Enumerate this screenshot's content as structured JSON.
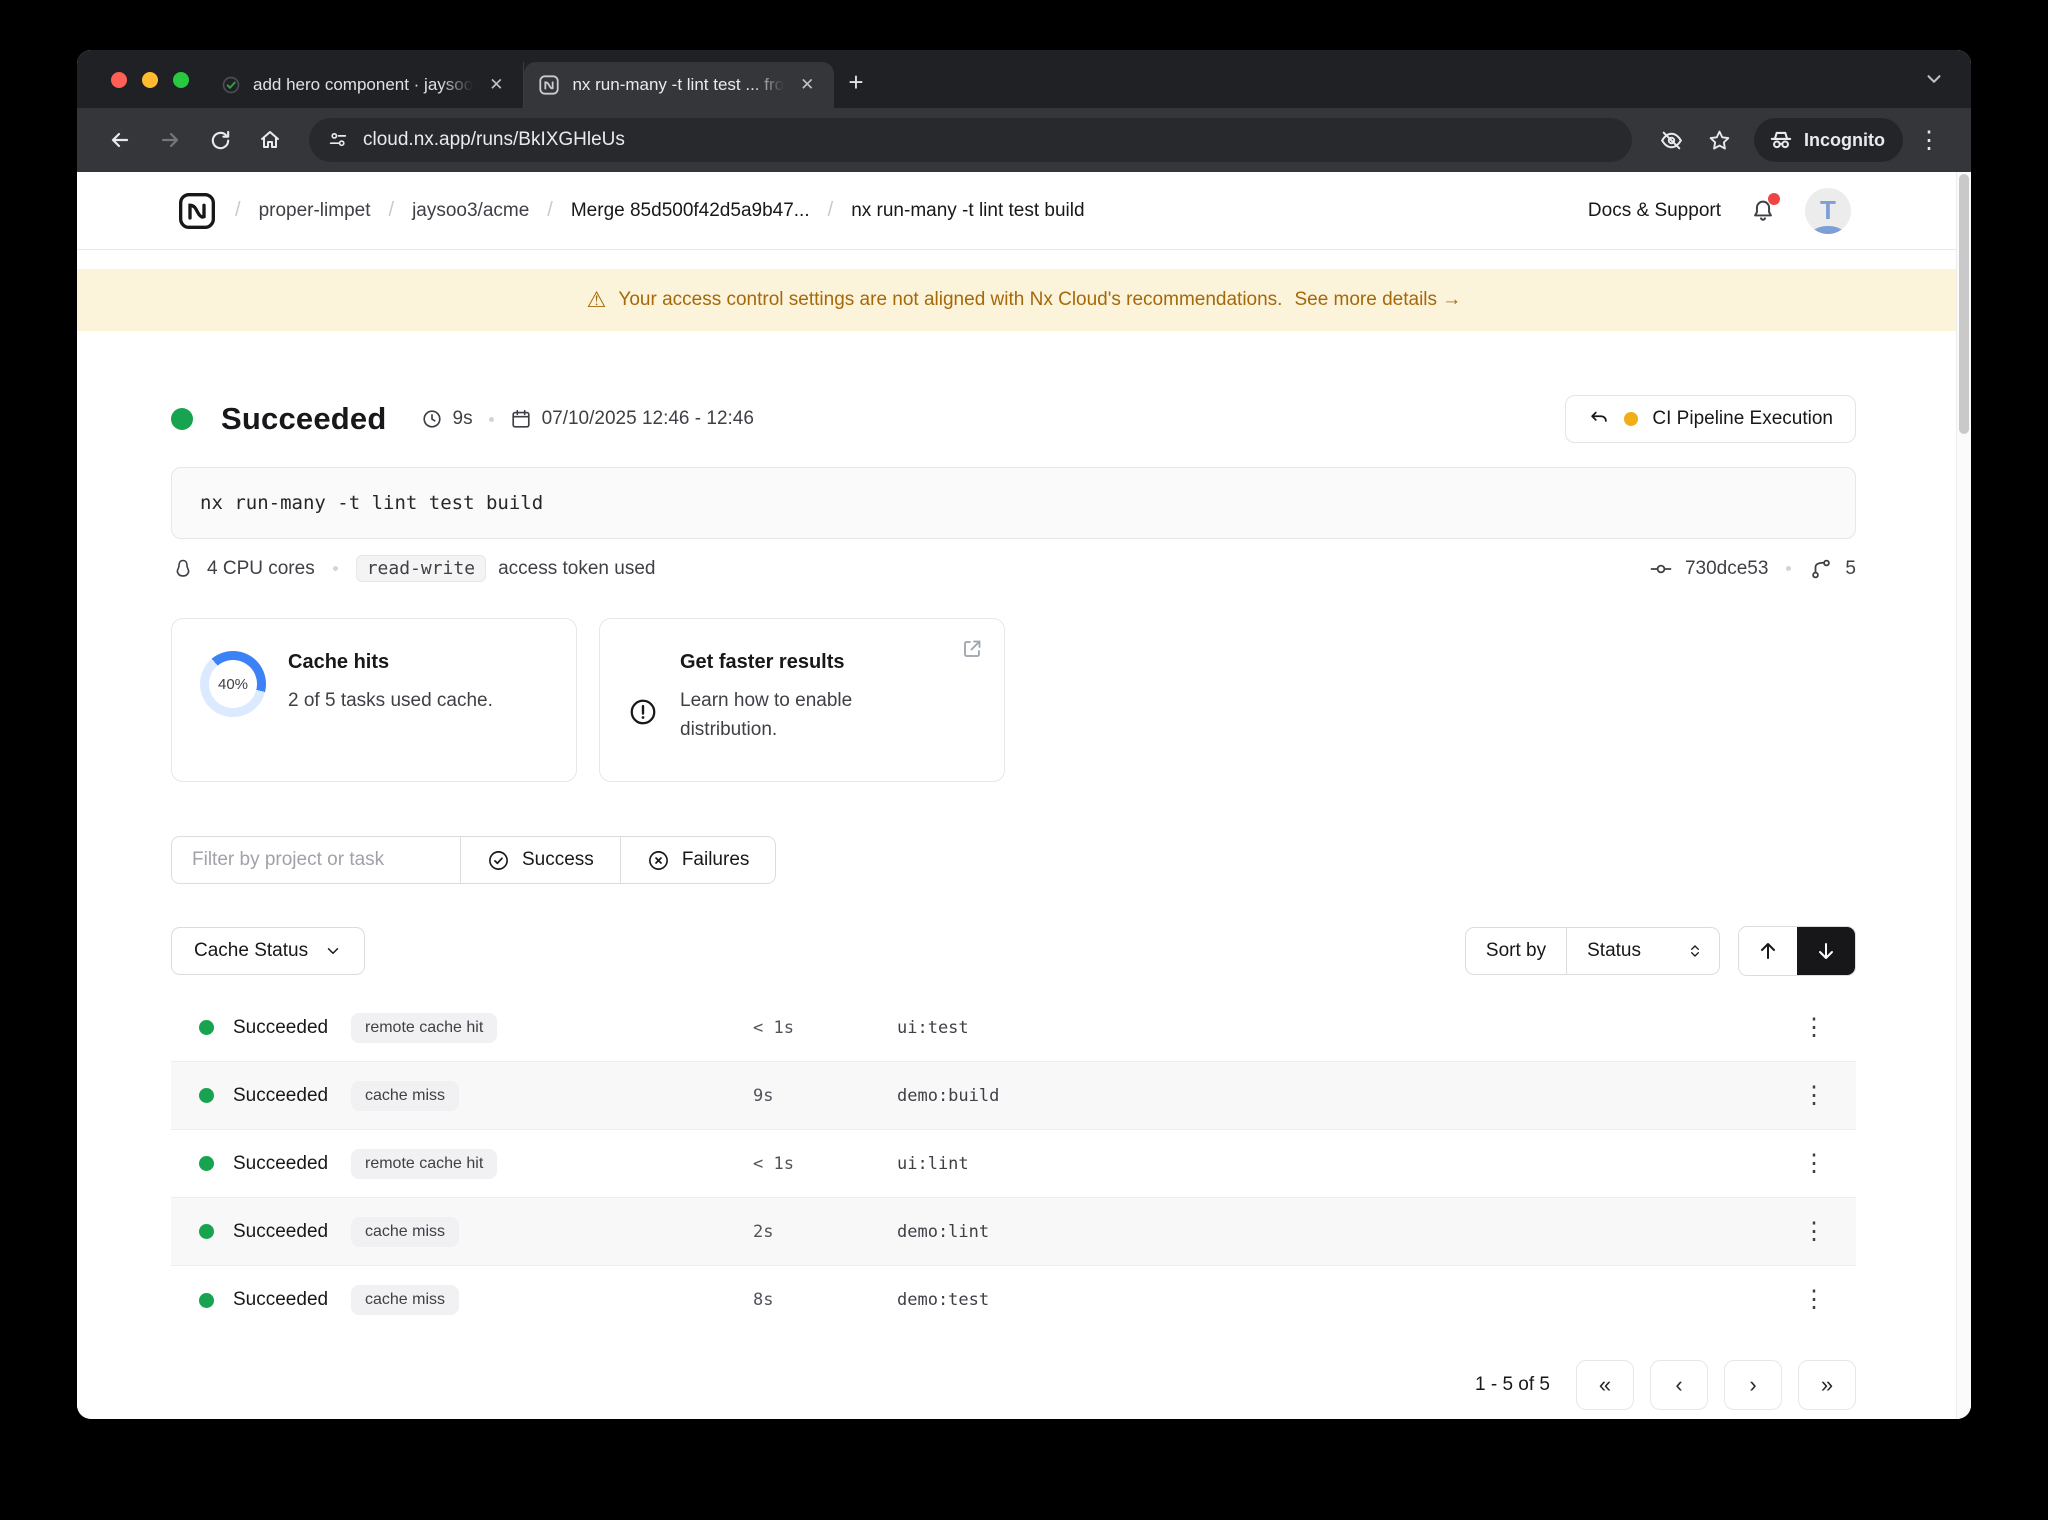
{
  "browser": {
    "tabs": [
      {
        "label": "add hero component · jaysoo"
      },
      {
        "label": "nx run-many -t lint test ... fro"
      }
    ],
    "new_tab_label": "+",
    "url": "cloud.nx.app/runs/BkIXGHleUs",
    "incognito_label": "Incognito",
    "kebab_glyph": "⋮"
  },
  "header": {
    "breadcrumbs": [
      {
        "label": "proper-limpet"
      },
      {
        "label": "jaysoo3/acme"
      },
      {
        "label": "Merge 85d500f42d5a9b47..."
      },
      {
        "label": "nx run-many -t lint test build"
      }
    ],
    "separator": "/",
    "docs_support": "Docs & Support",
    "avatar_initial": "T"
  },
  "banner": {
    "warning_glyph": "⚠",
    "message": "Your access control settings are not aligned with Nx Cloud's recommendations.",
    "link": "See more details →"
  },
  "run": {
    "status": "Succeeded",
    "duration": "9s",
    "date_range": "07/10/2025 12:46 - 12:46",
    "pipeline_button": "CI Pipeline Execution",
    "command": "nx run-many -t lint test build",
    "cpu": "4 CPU cores",
    "token_chip": "read-write",
    "token_suffix": "access token used",
    "commit": "730dce53",
    "branch_count": "5"
  },
  "cards": {
    "cache_hits": {
      "percent": "40%",
      "title": "Cache hits",
      "subtitle": "2 of 5 tasks used cache."
    },
    "faster_results": {
      "title": "Get faster results",
      "body": "Learn how to enable distribution."
    }
  },
  "filters": {
    "placeholder": "Filter by project or task",
    "success": "Success",
    "failures": "Failures",
    "cache_status": "Cache Status",
    "sort_by": "Sort by",
    "sort_value": "Status"
  },
  "table": {
    "rows": [
      {
        "status": "Succeeded",
        "badge": "remote cache hit",
        "duration": "< 1s",
        "task": "ui:test",
        "kebab": "⋮"
      },
      {
        "status": "Succeeded",
        "badge": "cache miss",
        "duration": "9s",
        "task": "demo:build",
        "kebab": "⋮"
      },
      {
        "status": "Succeeded",
        "badge": "remote cache hit",
        "duration": "< 1s",
        "task": "ui:lint",
        "kebab": "⋮"
      },
      {
        "status": "Succeeded",
        "badge": "cache miss",
        "duration": "2s",
        "task": "demo:lint",
        "kebab": "⋮"
      },
      {
        "status": "Succeeded",
        "badge": "cache miss",
        "duration": "8s",
        "task": "demo:test",
        "kebab": "⋮"
      }
    ]
  },
  "pagination": {
    "label": "1 - 5 of 5",
    "first": "«",
    "prev": "‹",
    "next": "›",
    "last": "»"
  },
  "colors": {
    "success_green": "#17a34f",
    "accent_blue": "#3b82f6",
    "donut_track": "#dbeafe",
    "banner_bg": "#fbf3da",
    "banner_text": "#a5690a",
    "pending_yellow": "#f2ae16",
    "notification_red": "#ef4444"
  }
}
